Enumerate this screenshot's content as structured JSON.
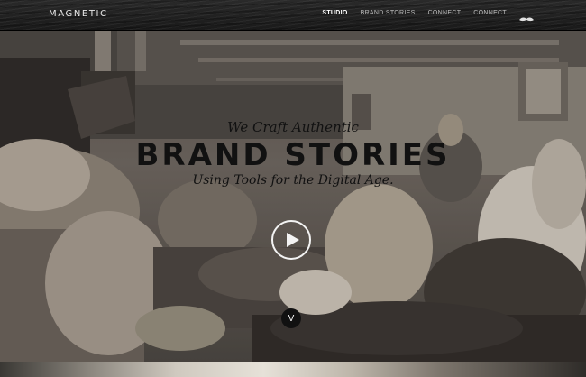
{
  "header": {
    "logo": "MAGNETIC",
    "nav": [
      {
        "label": "STUDIO",
        "active": true
      },
      {
        "label": "BRAND STORIES",
        "active": false
      },
      {
        "label": "CONNECT",
        "active": false
      },
      {
        "label": "CONNECT",
        "active": false
      }
    ],
    "mustache_icon": "mustache-icon"
  },
  "hero": {
    "tagline_top": "We Craft Authentic",
    "headline": "BRAND STORIES",
    "tagline_bottom": "Using Tools for the Digital Age.",
    "play_icon": "play-icon",
    "scroll_down_label": "V"
  }
}
